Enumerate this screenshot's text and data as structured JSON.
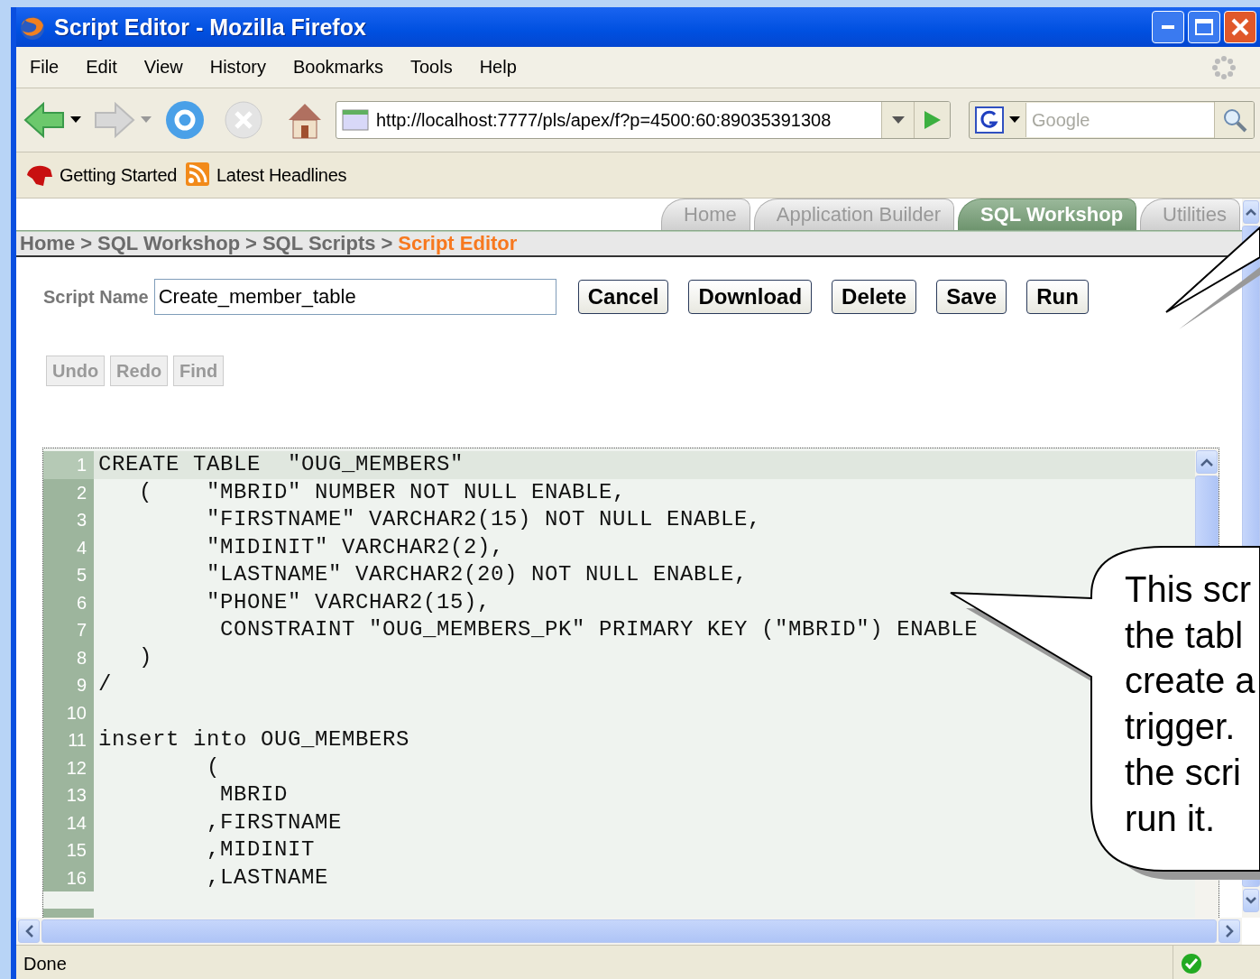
{
  "window": {
    "title": "Script Editor - Mozilla Firefox"
  },
  "menu": [
    "File",
    "Edit",
    "View",
    "History",
    "Bookmarks",
    "Tools",
    "Help"
  ],
  "address_bar": {
    "url": "http://localhost:7777/pls/apex/f?p=4500:60:89035391308"
  },
  "search": {
    "placeholder": "Google"
  },
  "bookmarks": [
    "Getting Started",
    "Latest Headlines"
  ],
  "tabs": [
    {
      "label": "Home",
      "selected": false
    },
    {
      "label": "Application Builder",
      "selected": false
    },
    {
      "label": "SQL Workshop",
      "selected": true
    },
    {
      "label": "Utilities",
      "selected": false
    }
  ],
  "breadcrumb": {
    "separator": ">",
    "items": [
      {
        "label": "Home",
        "current": false
      },
      {
        "label": "SQL Workshop",
        "current": false
      },
      {
        "label": "SQL Scripts",
        "current": false
      },
      {
        "label": "Script Editor",
        "current": true
      }
    ]
  },
  "script_name": {
    "label": "Script Name",
    "value": "Create_member_table"
  },
  "actions": [
    "Cancel",
    "Download",
    "Delete",
    "Save",
    "Run"
  ],
  "editor_tools": [
    {
      "label": "Undo",
      "disabled": true
    },
    {
      "label": "Redo",
      "disabled": true
    },
    {
      "label": "Find",
      "disabled": true
    }
  ],
  "editor": {
    "lines": [
      {
        "number": "1",
        "code": "CREATE TABLE  \"OUG_MEMBERS\"",
        "current": true
      },
      {
        "number": "2",
        "code": "   (    \"MBRID\" NUMBER NOT NULL ENABLE,",
        "current": false
      },
      {
        "number": "3",
        "code": "        \"FIRSTNAME\" VARCHAR2(15) NOT NULL ENABLE,",
        "current": false
      },
      {
        "number": "4",
        "code": "        \"MIDINIT\" VARCHAR2(2),",
        "current": false
      },
      {
        "number": "5",
        "code": "        \"LASTNAME\" VARCHAR2(20) NOT NULL ENABLE,",
        "current": false
      },
      {
        "number": "6",
        "code": "        \"PHONE\" VARCHAR2(15),",
        "current": false
      },
      {
        "number": "7",
        "code": "         CONSTRAINT \"OUG_MEMBERS_PK\" PRIMARY KEY (\"MBRID\") ENABLE",
        "current": false
      },
      {
        "number": "8",
        "code": "   )",
        "current": false
      },
      {
        "number": "9",
        "code": "/",
        "current": false
      },
      {
        "number": "10",
        "current": false
      },
      {
        "number": "11",
        "code": "insert into OUG_MEMBERS",
        "current": false
      },
      {
        "number": "12",
        "code": "        (",
        "current": false
      },
      {
        "number": "13",
        "code": "         MBRID",
        "current": false
      },
      {
        "number": "14",
        "code": "        ,FIRSTNAME",
        "current": false
      },
      {
        "number": "15",
        "code": "        ,MIDINIT",
        "current": false
      },
      {
        "number": "16",
        "code": "        ,LASTNAME",
        "current": false
      }
    ]
  },
  "status_bar": {
    "text": "Done"
  },
  "callout": {
    "text": "This scr\nthe tabl\ncreate a\ntrigger.\nthe scri\nrun it."
  }
}
